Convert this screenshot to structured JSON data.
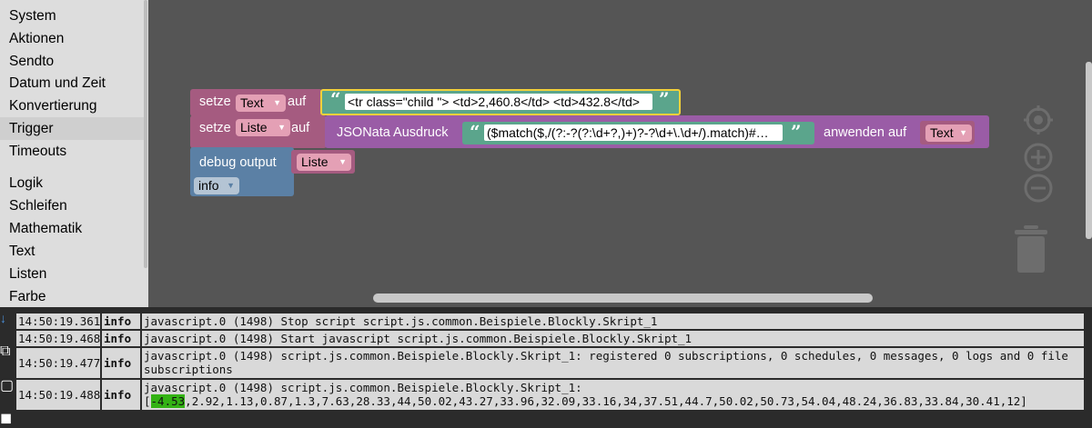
{
  "toolbox": {
    "categories": [
      "System",
      "Aktionen",
      "Sendto",
      "Datum und Zeit",
      "Konvertierung",
      "Trigger",
      "Timeouts"
    ],
    "categories2": [
      "Logik",
      "Schleifen",
      "Mathematik",
      "Text",
      "Listen",
      "Farbe"
    ],
    "selected": "Trigger"
  },
  "blocks": {
    "set1": {
      "label": "setze",
      "var": "Text",
      "auf": "auf",
      "string": "<tr class=\"child \"> <td>2,460.8</td> <td>432.8</td>"
    },
    "set2": {
      "label": "setze",
      "var": "Liste",
      "auf": "auf"
    },
    "jsonata": {
      "label": "JSONata Ausdruck",
      "expr": " ($match($,/(?:-?(?:\\d+?,)+)?-?\\d+\\.\\d+/).match)#…",
      "apply": "anwenden auf",
      "var": "Text"
    },
    "debug": {
      "label": "debug output",
      "var": "Liste",
      "level": "info"
    }
  },
  "log": [
    {
      "time": "14:50:19.361",
      "level": "info",
      "msg": "javascript.0 (1498) Stop script script.js.common.Beispiele.Blockly.Skript_1"
    },
    {
      "time": "14:50:19.468",
      "level": "info",
      "msg": "javascript.0 (1498) Start javascript script.js.common.Beispiele.Blockly.Skript_1"
    },
    {
      "time": "14:50:19.477",
      "level": "info",
      "msg": "javascript.0 (1498) script.js.common.Beispiele.Blockly.Skript_1: registered 0 subscriptions, 0 schedules, 0 messages, 0 logs and 0 file subscriptions"
    },
    {
      "time": "14:50:19.488",
      "level": "info",
      "msg_line1": "javascript.0 (1498) script.js.common.Beispiele.Blockly.Skript_1:",
      "msg_prefix": "[",
      "msg_highlight": "-4.53",
      "msg_rest": ",2.92,1.13,0.87,1.3,7.63,28.33,44,50.02,43.27,33.96,32.09,33.16,34,37.51,44.7,50.02,50.73,54.04,48.24,36.83,33.84,30.41,12]"
    }
  ],
  "colors": {
    "workspace": "#555555",
    "variables": "#a55b80",
    "text": "#5ba58c",
    "jsonata": "#9a5ca6",
    "debug": "#5b80a5",
    "highlight": "#33b214"
  }
}
